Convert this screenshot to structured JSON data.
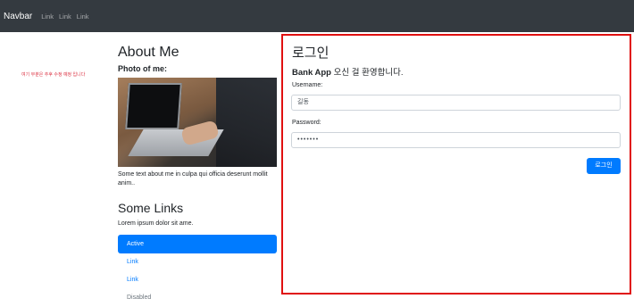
{
  "navbar": {
    "brand": "Navbar",
    "links": [
      "Link",
      "Link",
      "Link"
    ]
  },
  "note": "여기 부분은 추후 수정 예정 입니다",
  "profile": {
    "title": "About Me",
    "photo_label": "Photo of me:",
    "photo_text": "Some text about me in culpa qui officia deserunt mollit anim..",
    "links_title": "Some Links",
    "links_text": "Lorem ipsum dolor sit ame.",
    "nav_items": [
      {
        "label": "Active",
        "state": "active"
      },
      {
        "label": "Link",
        "state": "normal"
      },
      {
        "label": "Link",
        "state": "normal"
      },
      {
        "label": "Disabled",
        "state": "disabled"
      }
    ]
  },
  "login": {
    "title": "로그인",
    "welcome_app": "Bank App",
    "welcome_text": " 오신 걸 환영합니다.",
    "username_label": "Username:",
    "username_value": "길동",
    "password_label": "Password:",
    "password_value": "•••••••",
    "button_label": "로그인"
  },
  "colors": {
    "navbar_bg": "#343a40",
    "accent": "#007bff",
    "panel_border": "#e01010",
    "note_text": "#dc3545"
  }
}
